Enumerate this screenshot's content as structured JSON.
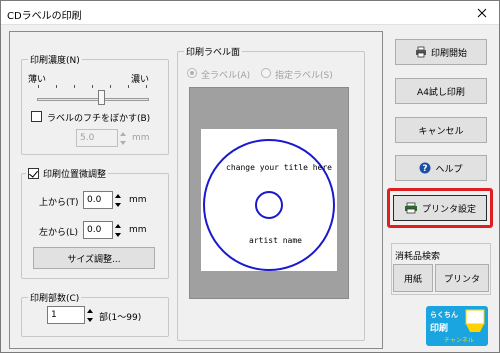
{
  "window": {
    "title": "CDラベルの印刷"
  },
  "density": {
    "legend": "印刷濃度(N)",
    "light_label": "薄い",
    "dark_label": "濃い",
    "level": 0.58,
    "blur_label": "ラベルのフチをぼかす(B)",
    "blur_checked": false,
    "blur_value": "5.0",
    "blur_unit": "mm"
  },
  "position": {
    "legend": "印刷位置微調整",
    "checked": true,
    "top_label": "上から(T)",
    "top_value": "0.0",
    "top_unit": "mm",
    "left_label": "左から(L)",
    "left_value": "0.0",
    "left_unit": "mm",
    "size_button": "サイズ調整..."
  },
  "copies": {
    "legend": "印刷部数(C)",
    "value": "1",
    "range": "部(1〜99)"
  },
  "preview": {
    "legend": "印刷ラベル面",
    "all_label": "全ラベル(A)",
    "specified_label": "指定ラベル(S)",
    "selected": "all",
    "title_text": "change your title here",
    "artist_text": "artist name",
    "disc_color": "#1a1acc"
  },
  "buttons": {
    "print": "印刷開始",
    "test_print": "A4試し印刷",
    "cancel": "キャンセル",
    "help": "ヘルプ",
    "printer_settings": "プリンタ設定"
  },
  "supplies": {
    "title": "消耗品検索",
    "paper": "用紙",
    "printer": "プリンタ"
  },
  "logo": {
    "line1": "らくちん",
    "line2": "印刷",
    "line3": "チャンネル"
  },
  "colors": {
    "highlight": "#e02020",
    "logo_bg": "#1aa4e0",
    "logo_accent": "#ffd200"
  }
}
